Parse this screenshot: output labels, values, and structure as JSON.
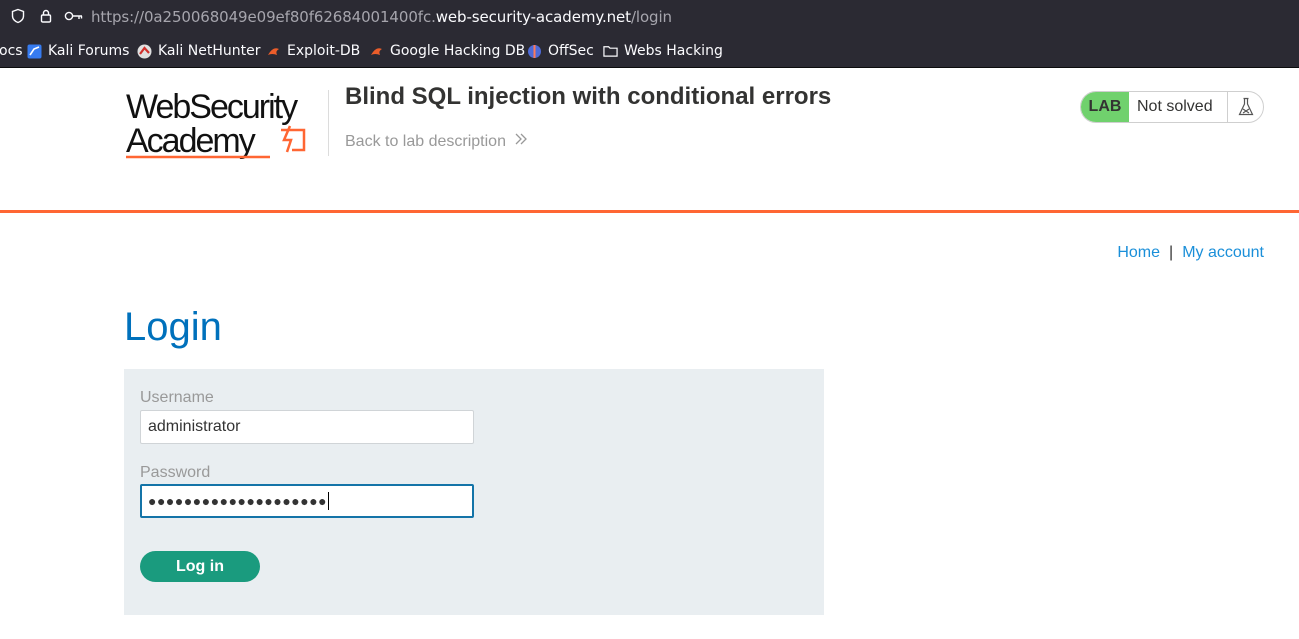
{
  "browser": {
    "url_prefix": "https://0a250068049e09ef80f62684001400fc.",
    "url_host": "web-security-academy.net",
    "url_path": "/login",
    "icons": [
      "shield-icon",
      "lock-icon",
      "key-icon"
    ],
    "bookmarks": [
      {
        "label": "ocs",
        "icon": "none"
      },
      {
        "label": "Kali Forums",
        "icon": "kali-forums-icon"
      },
      {
        "label": "Kali NetHunter",
        "icon": "kali-nethunter-icon"
      },
      {
        "label": "Exploit-DB",
        "icon": "exploit-db-icon"
      },
      {
        "label": "Google Hacking DB",
        "icon": "ghdb-icon"
      },
      {
        "label": "OffSec",
        "icon": "offsec-icon"
      },
      {
        "label": "Webs Hacking",
        "icon": "folder-icon"
      }
    ]
  },
  "header": {
    "logo_text_line1": "WebSecurity",
    "logo_text_line2": "Academy",
    "lab_title": "Blind SQL injection with conditional errors",
    "back_link": "Back to lab description",
    "lab_tag": "LAB",
    "lab_state": "Not solved",
    "accent": "#ff6633",
    "lab_tag_color": "#70d16d"
  },
  "nav": {
    "home": "Home",
    "separator": "|",
    "account": "My account"
  },
  "login": {
    "title": "Login",
    "username_label": "Username",
    "username_value": "administrator",
    "password_label": "Password",
    "password_masked": "●●●●●●●●●●●●●●●●●●●●",
    "submit_label": "Log in",
    "button_color": "#1a9b7e"
  }
}
